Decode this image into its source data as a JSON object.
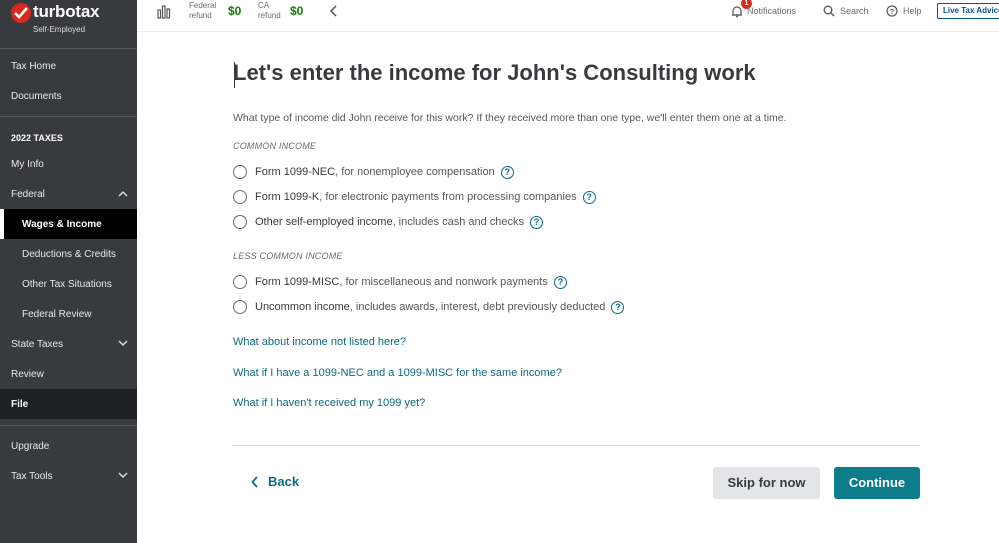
{
  "brand": {
    "name": "turbotax",
    "edition": "Self-Employed",
    "red": "#d52b1e"
  },
  "sidebar": {
    "items_top": [
      {
        "label": "Tax Home"
      },
      {
        "label": "Documents"
      }
    ],
    "section_heading": "2022 TAXES",
    "items": [
      {
        "label": "My Info"
      },
      {
        "label": "Federal"
      },
      {
        "label": "Wages & Income"
      },
      {
        "label": "Deductions & Credits"
      },
      {
        "label": "Other Tax Situations"
      },
      {
        "label": "Federal Review"
      },
      {
        "label": "State Taxes"
      },
      {
        "label": "Review"
      },
      {
        "label": "File"
      }
    ],
    "items_bottom": [
      {
        "label": "Upgrade"
      },
      {
        "label": "Tax Tools"
      }
    ]
  },
  "topbar": {
    "federal_label_1": "Federal",
    "federal_label_2": "refund",
    "federal_amount": "$0",
    "ca_label_1": "CA",
    "ca_label_2": "refund",
    "ca_amount": "$0",
    "notifications_label": "Notifications",
    "notifications_count": "1",
    "search_label": "Search",
    "help_label": "Help",
    "live_label": "Live Tax Advice"
  },
  "main": {
    "title": "Let's enter the income for John's Consulting work",
    "question": "What type of income did John receive for this work? If they received more than one type, we'll enter them one at a time.",
    "common_label": "COMMON INCOME",
    "common_options": [
      {
        "strong": "Form 1099-NEC",
        "rest": ", for nonemployee compensation"
      },
      {
        "strong": "Form 1099-K",
        "rest": ", for electronic payments from processing companies"
      },
      {
        "strong": "Other self-employed income",
        "rest": ", includes cash and checks"
      }
    ],
    "less_common_label": "LESS COMMON INCOME",
    "less_common_options": [
      {
        "strong": "Form 1099-MISC",
        "rest": ", for miscellaneous and nonwork payments"
      },
      {
        "strong": "Uncommon income",
        "rest": ", includes awards, interest, debt previously deducted"
      }
    ],
    "links": [
      "What about income not listed here?",
      "What if I have a 1099-NEC and a 1099-MISC for the same income?",
      "What if I haven't received my 1099 yet?"
    ],
    "back_label": "Back",
    "skip_label": "Skip for now",
    "continue_label": "Continue",
    "accent": "#0d7c8b"
  }
}
